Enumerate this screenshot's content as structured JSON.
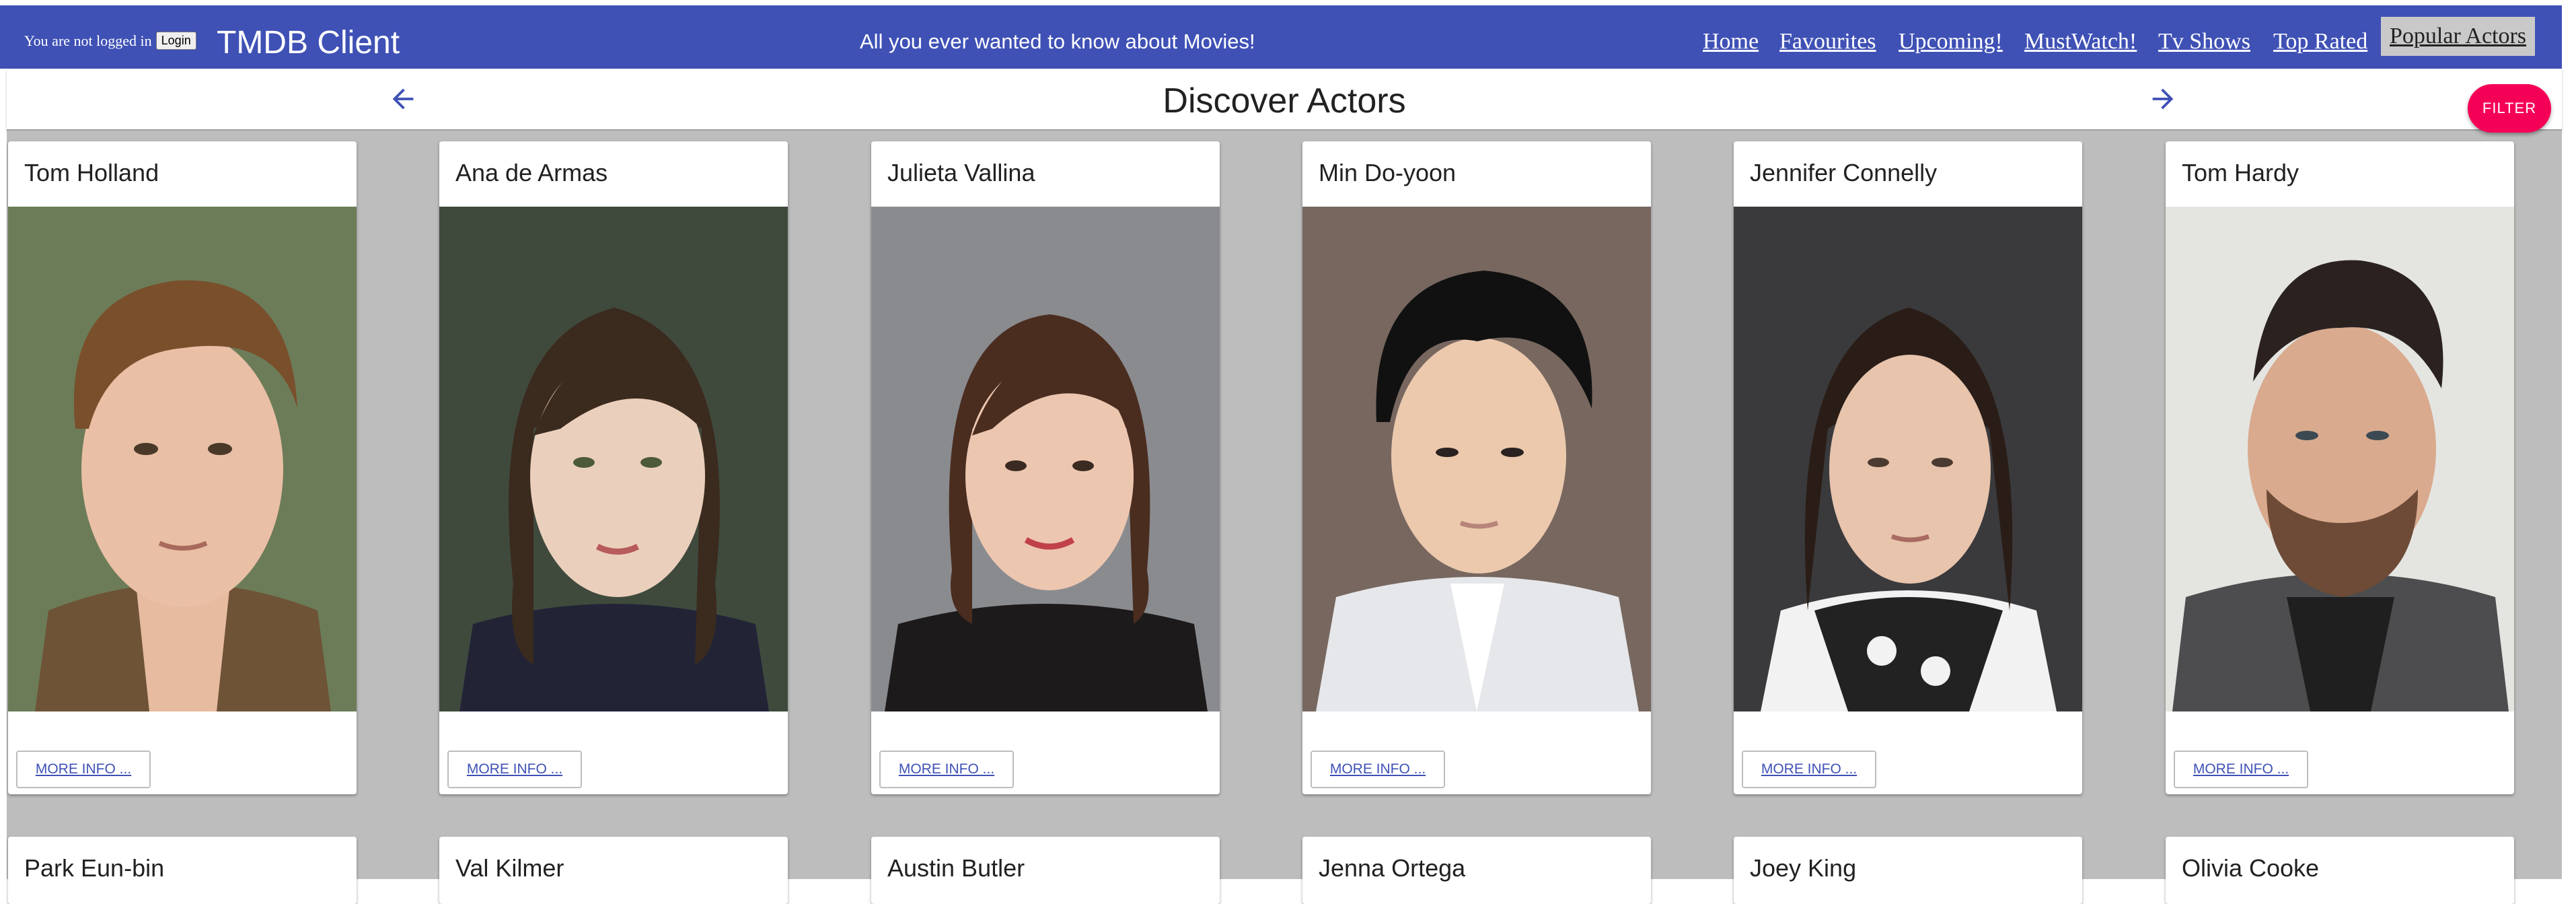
{
  "header": {
    "login_status": "You are not logged in",
    "login_button": "Login",
    "brand": "TMDB Client",
    "tagline": "All you ever wanted to know about Movies!",
    "nav": [
      "Home",
      "Favourites",
      "Upcoming!",
      "MustWatch!",
      "Tv Shows",
      "Top Rated",
      "Popular Actors"
    ],
    "active_nav": "Popular Actors"
  },
  "page": {
    "title": "Discover Actors",
    "prev_icon": "arrow-left-icon",
    "next_icon": "arrow-right-icon",
    "filter_label": "FILTER"
  },
  "actors": [
    {
      "name": "Tom Holland",
      "more": "MORE INFO ..."
    },
    {
      "name": "Ana de Armas",
      "more": "MORE INFO ..."
    },
    {
      "name": "Julieta Vallina",
      "more": "MORE INFO ..."
    },
    {
      "name": "Min Do-yoon",
      "more": "MORE INFO ..."
    },
    {
      "name": "Jennifer Connelly",
      "more": "MORE INFO ..."
    },
    {
      "name": "Tom Hardy",
      "more": "MORE INFO ..."
    },
    {
      "name": "Park Eun-bin"
    },
    {
      "name": "Val Kilmer"
    },
    {
      "name": "Austin Butler"
    },
    {
      "name": "Jenna Ortega"
    },
    {
      "name": "Joey King"
    },
    {
      "name": "Olivia Cooke"
    }
  ],
  "colors": {
    "primary": "#3f51b5",
    "accent": "#f50057",
    "grid_bg": "#bdbdbd"
  }
}
